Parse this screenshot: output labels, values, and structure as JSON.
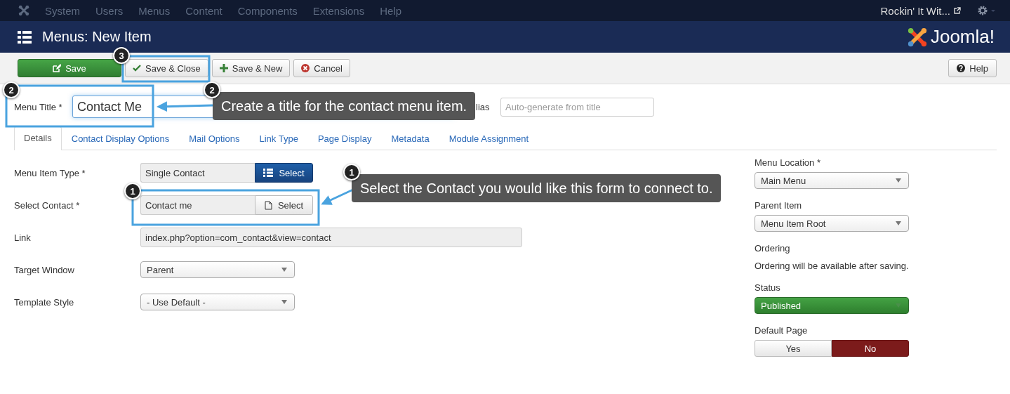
{
  "top_menu": {
    "items": [
      "System",
      "Users",
      "Menus",
      "Content",
      "Components",
      "Extensions",
      "Help"
    ],
    "site_link": "Rockin' It Wit..."
  },
  "header": {
    "title": "Menus: New Item",
    "logo_text": "Joomla!"
  },
  "toolbar": {
    "buttons": [
      {
        "label": "Save",
        "kind": "save"
      },
      {
        "label": "Save & Close",
        "kind": "save-close"
      },
      {
        "label": "Save & New",
        "kind": "save-new"
      },
      {
        "label": "Cancel",
        "kind": "cancel"
      }
    ],
    "help": "Help"
  },
  "title_field": {
    "label": "Menu Title *",
    "value": "Contact Me"
  },
  "alias_field": {
    "label": "lias",
    "placeholder": "Auto-generate from title"
  },
  "tabs": [
    {
      "label": "Details",
      "selected": true
    },
    {
      "label": "Contact Display Options",
      "selected": false
    },
    {
      "label": "Mail Options",
      "selected": false
    },
    {
      "label": "Link Type",
      "selected": false
    },
    {
      "label": "Page Display",
      "selected": false
    },
    {
      "label": "Metadata",
      "selected": false
    },
    {
      "label": "Module Assignment",
      "selected": false
    }
  ],
  "fields": [
    {
      "label": "Menu Item Type *",
      "kind": "picker",
      "value": "Single Contact",
      "button": "Select",
      "primary": true
    },
    {
      "label": "Select Contact *",
      "kind": "picker",
      "value": "Contact me",
      "button": "Select",
      "primary": false
    },
    {
      "label": "Link",
      "kind": "readonly",
      "value": "index.php?option=com_contact&view=contact"
    },
    {
      "label": "Target Window",
      "kind": "select",
      "value": "Parent"
    },
    {
      "label": "Template Style",
      "kind": "select",
      "value": "- Use Default -"
    }
  ],
  "side_fields": [
    {
      "label": "Menu Location *",
      "kind": "select",
      "value": "Main Menu"
    },
    {
      "label": "Parent Item",
      "kind": "select",
      "value": "Menu Item Root"
    },
    {
      "label": "Ordering",
      "kind": "note",
      "value": "Ordering will be available after saving."
    },
    {
      "label": "Status",
      "kind": "status",
      "value": "Published"
    },
    {
      "label": "Default Page",
      "kind": "toggle",
      "options": [
        {
          "label": "Yes",
          "selected": false
        },
        {
          "label": "No",
          "selected": true
        }
      ]
    }
  ],
  "annotations": {
    "highlights": [
      {
        "number": "3"
      },
      {
        "number": "2"
      },
      {
        "number": "1"
      }
    ],
    "callouts": [
      {
        "number": "2",
        "text": "Create a title for the contact menu item."
      },
      {
        "number": "1",
        "text": "Select the Contact you would like this form to connect to."
      }
    ]
  }
}
